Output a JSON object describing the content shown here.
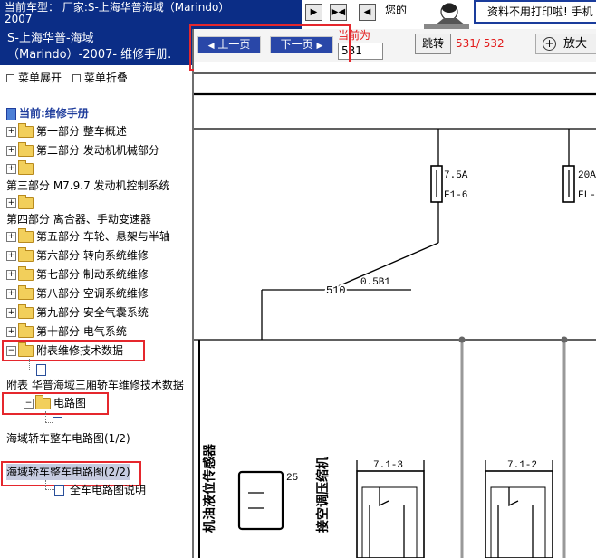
{
  "header": {
    "vehicle_line1": "当前车型：  厂家:S-上海华普海域（Marindo）",
    "vehicle_line2": "2007",
    "ad_text": "您的",
    "ad_banner": "资料不用打印啦! 手机"
  },
  "sidebar": {
    "doc_title_line1": "S-上海华普-海域",
    "doc_title_line2": "（Marindo）-2007- 维修手册.",
    "expand_label": "菜单展开",
    "collapse_label": "菜单折叠",
    "root_label": "当前:维修手册",
    "items": [
      "第一部分 整车概述",
      "第二部分 发动机机械部分",
      "第三部分 M7.9.7 发动机控制系统",
      "第四部分 离合器、手动变速器",
      "第五部分 车轮、悬架与半轴",
      "第六部分 转向系统维修",
      "第七部分 制动系统维修",
      "第八部分 空调系统维修",
      "第九部分 安全气囊系统",
      "第十部分 电气系统",
      "附表维修技术数据",
      "附表 华普海域三厢轿车维修技术数据",
      "电路图",
      "海域轿车整车电路图(1/2)",
      "海域轿车整车电路图(2/2)",
      "全车电路图说明"
    ]
  },
  "toolbar": {
    "prev_label": "上一页",
    "next_label": "下一页",
    "current_label": "当前为",
    "current_page": "531",
    "jump_label": "跳转",
    "page_count": "531/ 532",
    "zoom_label": "放大"
  },
  "diagram": {
    "fuse1_rating": "7.5A",
    "fuse1_id": "F1-6",
    "fuse2_rating": "20A",
    "fuse2_id": "FL-",
    "wire_number": "510",
    "wire_spec": "0.5B1",
    "relay1": "7.1-3",
    "relay2": "7.1-2",
    "vertical_label": "接空调压缩机",
    "left_label": "机油液位传感器",
    "connector_pin": "25"
  },
  "colors": {
    "header_blue": "#0b2d86",
    "button_blue": "#2947a8",
    "highlight_red": "#e5272d"
  }
}
